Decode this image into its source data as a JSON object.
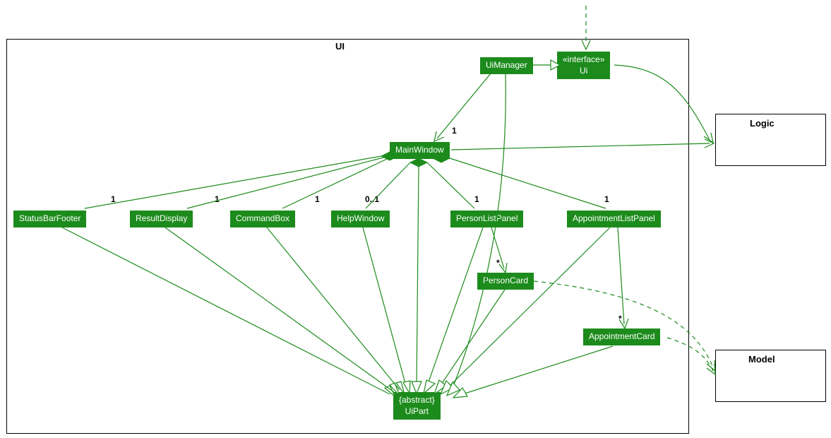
{
  "packages": {
    "ui": "UI",
    "logic": "Logic",
    "model": "Model"
  },
  "classes": {
    "uiManager": "UiManager",
    "uiInterface": "«interface»\nUi",
    "mainWindow": "MainWindow",
    "statusBarFooter": "StatusBarFooter",
    "resultDisplay": "ResultDisplay",
    "commandBox": "CommandBox",
    "helpWindow": "HelpWindow",
    "personListPanel": "PersonListPanel",
    "appointmentListPanel": "AppointmentListPanel",
    "personCard": "PersonCard",
    "appointmentCard": "AppointmentCard",
    "uiPart": "{abstract}\nUiPart"
  },
  "multiplicities": {
    "mainWindow_one": "1",
    "statusBarFooter_one": "1",
    "resultDisplay_one": "1",
    "commandBox_one": "1",
    "helpWindow_zeroone": "0..1",
    "personListPanel_one": "1",
    "appointmentListPanel_one": "1",
    "personCard_star": "*",
    "appointmentCard_star": "*"
  }
}
